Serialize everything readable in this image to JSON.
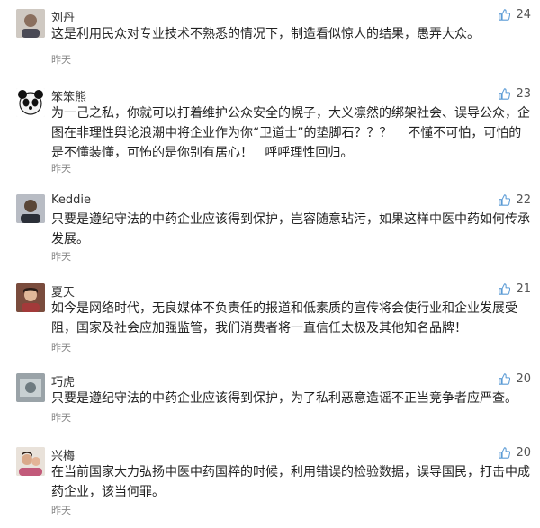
{
  "comments": [
    {
      "user": "刘丹",
      "text": "这是利用民众对专业技术不熟悉的情况下，制造看似惊人的结果，愚弄大众。",
      "time": "昨天",
      "likes": "24",
      "avatar_icon": "user-photo-avatar-icon"
    },
    {
      "user": "笨笨熊",
      "text": "为一己之私，你就可以打着维护公众安全的幌子，大义凛然的绑架社会、误导公众，企图在非理性舆论浪潮中将企业作为你“卫道士”的垫脚石？？？    不懂不可怕，可怕的是不懂装懂，可怖的是你别有居心！   呼呼理性回归。",
      "time": "昨天",
      "likes": "23",
      "avatar_icon": "panda-avatar-icon"
    },
    {
      "user": "Keddie",
      "text": "只要是遵纪守法的中药企业应该得到保护，岂容随意玷污，如果这样中医中药如何传承发展。",
      "time": "昨天",
      "likes": "22",
      "avatar_icon": "user-photo-avatar-icon"
    },
    {
      "user": "夏天",
      "text": "如今是网络时代，无良媒体不负责任的报道和低素质的宣传将会使行业和企业发展受阻，国家及社会应加强监管，我们消费者将一直信任太极及其他知名品牌！",
      "time": "昨天",
      "likes": "21",
      "avatar_icon": "user-photo-avatar-icon"
    },
    {
      "user": "巧虎",
      "text": "只要是遵纪守法的中药企业应该得到保护，为了私利恶意造谣不正当竞争者应严查。",
      "time": "昨天",
      "likes": "20",
      "avatar_icon": "user-photo-avatar-icon"
    },
    {
      "user": "兴梅",
      "text": "在当前国家大力弘扬中医中药国粹的时候，利用错误的检验数据，误导国民，打击中成药企业，该当何罪。",
      "time": "昨天",
      "likes": "20",
      "avatar_icon": "user-photo-avatar-icon"
    }
  ],
  "colors": {
    "like_icon": "#5b9bd5",
    "time_text": "#888888",
    "divider": "#eeeeee"
  }
}
